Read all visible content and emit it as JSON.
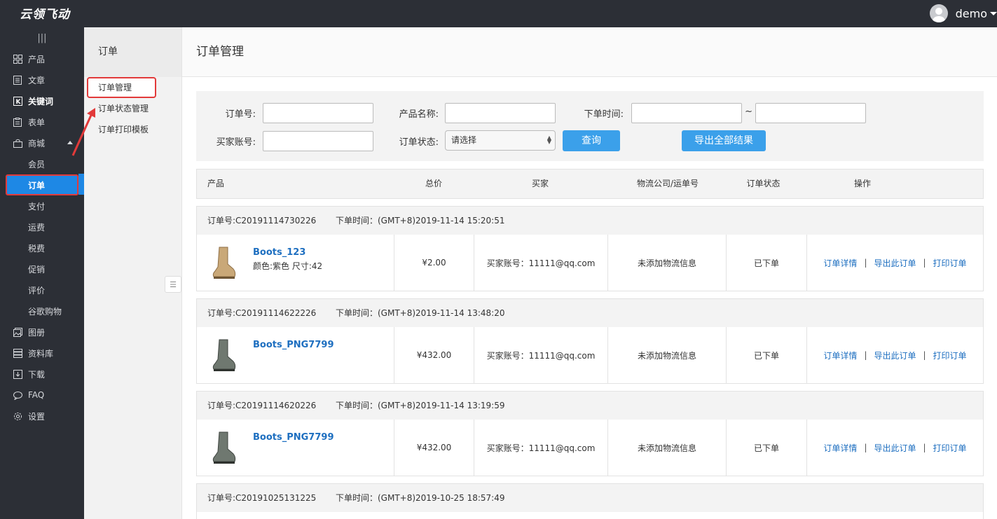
{
  "topbar": {
    "logo": "云领飞动",
    "username": "demo"
  },
  "sidebar": {
    "collapse_glyph": "|||",
    "items": [
      {
        "label": "产品",
        "icon": "grid-icon"
      },
      {
        "label": "文章",
        "icon": "document-icon"
      },
      {
        "label": "关键词",
        "icon": "k-box-icon"
      },
      {
        "label": "表单",
        "icon": "clipboard-icon"
      },
      {
        "label": "商城",
        "icon": "shop-bag-icon"
      },
      {
        "label": "会员"
      },
      {
        "label": "订单"
      },
      {
        "label": "支付"
      },
      {
        "label": "运费"
      },
      {
        "label": "税费"
      },
      {
        "label": "促销"
      },
      {
        "label": "评价"
      },
      {
        "label": "谷歌购物"
      },
      {
        "label": "图册",
        "icon": "album-icon"
      },
      {
        "label": "资料库",
        "icon": "database-icon"
      },
      {
        "label": "下载",
        "icon": "download-icon"
      },
      {
        "label": "FAQ",
        "icon": "chat-icon"
      },
      {
        "label": "设置",
        "icon": "gear-icon"
      }
    ]
  },
  "subpanel": {
    "title": "订单",
    "items": [
      "订单管理",
      "订单状态管理",
      "订单打印模板"
    ]
  },
  "main": {
    "title": "订单管理",
    "filter": {
      "order_no_label": "订单号:",
      "product_name_label": "产品名称:",
      "order_time_label": "下单时间:",
      "range_sep": "~",
      "buyer_label": "买家账号:",
      "status_label": "订单状态:",
      "status_value": "请选择",
      "query_button": "查询",
      "export_button": "导出全部结果"
    },
    "table_headers": [
      "产品",
      "总价",
      "买家",
      "物流公司/运单号",
      "订单状态",
      "操作"
    ],
    "orders": [
      {
        "no": "订单号:C20191114730226",
        "time": "下单时间：(GMT+8)2019-11-14 15:20:51",
        "product": "Boots_123",
        "attrs": "颜色:紫色  尺寸:42",
        "total": "¥2.00",
        "buyer": "买家账号：11111@qq.com",
        "logistics": "未添加物流信息",
        "status": "已下单",
        "thumb": "tan"
      },
      {
        "no": "订单号:C20191114622226",
        "time": "下单时间：(GMT+8)2019-11-14 13:48:20",
        "product": "Boots_PNG7799",
        "attrs": "",
        "total": "¥432.00",
        "buyer": "买家账号：11111@qq.com",
        "logistics": "未添加物流信息",
        "status": "已下单",
        "thumb": "gray"
      },
      {
        "no": "订单号:C20191114620226",
        "time": "下单时间：(GMT+8)2019-11-14 13:19:59",
        "product": "Boots_PNG7799",
        "attrs": "",
        "total": "¥432.00",
        "buyer": "买家账号：11111@qq.com",
        "logistics": "未添加物流信息",
        "status": "已下单",
        "thumb": "gray"
      },
      {
        "no": "订单号:C20191025131225",
        "time": "下单时间：(GMT+8)2019-10-25 18:57:49"
      }
    ],
    "ops": {
      "detail": "订单详情",
      "export": "导出此订单",
      "print": "打印订单",
      "sep": "|"
    }
  },
  "colors": {
    "accent": "#1e88e5",
    "button": "#3ba0ea",
    "link": "#1e6fc0",
    "highlight": "#e23a3a",
    "sidebar_bg": "#2c2f36"
  }
}
